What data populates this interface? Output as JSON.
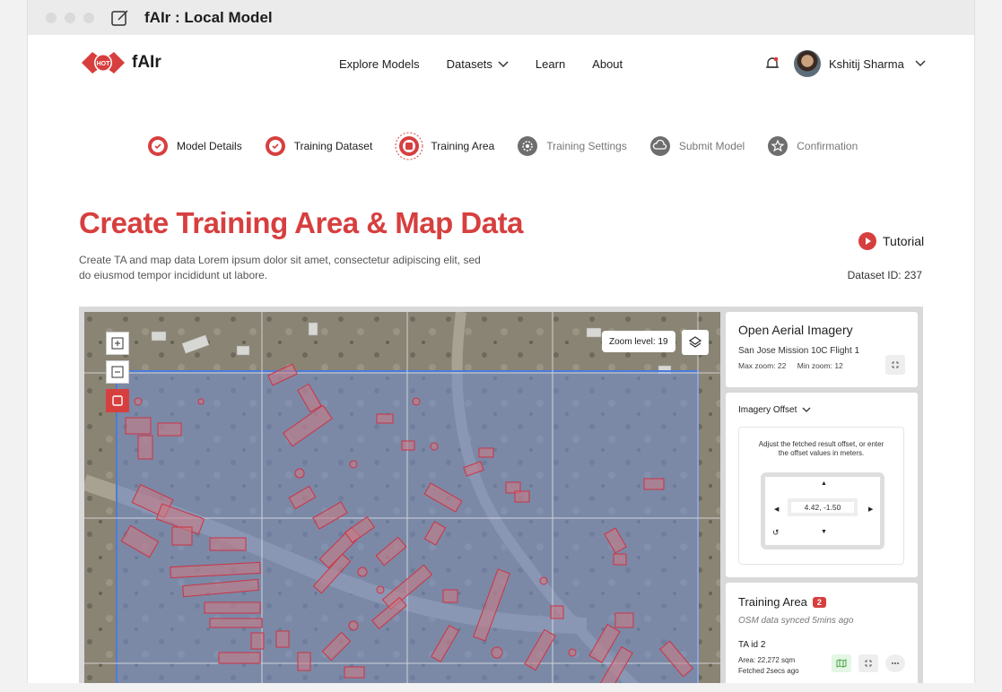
{
  "window": {
    "title": "fAIr : Local Model"
  },
  "brand": {
    "name": "fAIr",
    "logo_text": "HOT"
  },
  "nav": {
    "links": [
      "Explore Models",
      "Datasets",
      "Learn",
      "About"
    ],
    "user": "Kshitij Sharma"
  },
  "stepper": [
    {
      "label": "Model Details",
      "state": "done"
    },
    {
      "label": "Training Dataset",
      "state": "done"
    },
    {
      "label": "Training Area",
      "state": "current"
    },
    {
      "label": "Training Settings",
      "state": "pending"
    },
    {
      "label": "Submit Model",
      "state": "pending"
    },
    {
      "label": "Confirmation",
      "state": "pending"
    }
  ],
  "page": {
    "title": "Create Training Area & Map Data",
    "subtitle": "Create TA and map data Lorem ipsum dolor sit amet, consectetur adipiscing elit, sed do eiusmod tempor incididunt ut labore.",
    "tutorial": "Tutorial",
    "dataset_id": "Dataset ID: 237"
  },
  "map": {
    "zoom_label": "Zoom level: 19"
  },
  "imagery": {
    "title": "Open Aerial Imagery",
    "source": "San Jose Mission 10C Flight 1",
    "max_zoom": "Max zoom: 22",
    "min_zoom": "Min zoom: 12"
  },
  "offset": {
    "title": "Imagery Offset",
    "help": "Adjust the fetched result offset, or enter the offset values in meters.",
    "value": "4.42, -1.50"
  },
  "training_area": {
    "title": "Training Area",
    "count": "2",
    "sync": "OSM data synced 5mins ago",
    "id": "TA id 2",
    "area": "Area: 22,272 sqm",
    "fetched": "Fetched 2secs ago"
  },
  "colors": {
    "accent": "#d73f3f",
    "selection": "#4a7bdc"
  }
}
